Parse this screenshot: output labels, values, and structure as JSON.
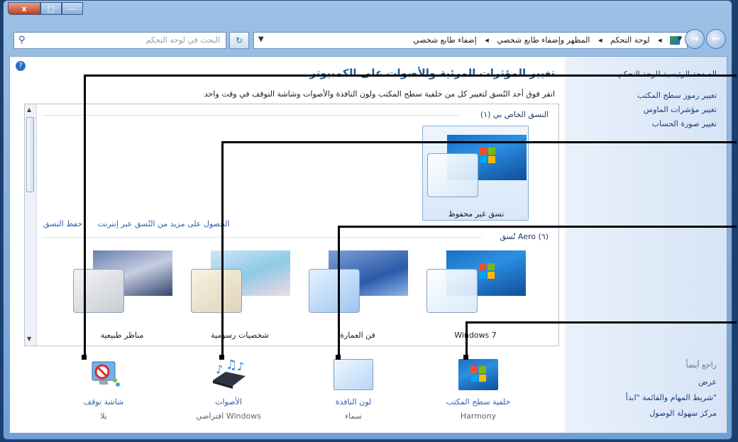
{
  "window": {
    "caption": {
      "close": "x",
      "maximize": "□",
      "minimize": "—"
    }
  },
  "address": {
    "search_placeholder": "البحث في لوحة التحكم",
    "crumbs": [
      "لوحة التحكم",
      "المظهر وإضفاء طابع شخصي",
      "إضفاء طابع شخصي"
    ],
    "separator": "◂"
  },
  "sidebar": {
    "home": "الصفحة الرئيسية للوحة التحكم",
    "links": [
      "تغيير رموز سطح المكتب",
      "تغيير مؤشرات الماوس",
      "تغيير صورة الحساب"
    ],
    "see_also": "راجع أيضاً",
    "see_links": [
      "عرض",
      "شريط المهام والقائمة \"ابدأ\"",
      "مركز سهولة الوصول"
    ]
  },
  "main": {
    "title": "تغيير المؤثرات المرئية والأصوات على الكمبيوتر",
    "description": "انقر فوق أحد النُسق لتغيير كل من خلفية سطح المكتب ولون النافذة والأصوات وشاشة التوقف في وقت واحد",
    "my_themes_header": "النسق الخاص بي (١)",
    "unsaved_theme": "نسق غير محفوظ",
    "save_theme": "حفظ النسق",
    "get_more": "الحصول على مزيد من النُسق عبر إنترنت",
    "aero_header": "نُسق Aero (٦)",
    "aero_themes": [
      "Windows 7",
      "فن العمارة",
      "شخصيات رسومية",
      "مناظر طبيعية"
    ]
  },
  "bottom": {
    "desktop_background": {
      "label": "خلفية سطح المكتب",
      "value": "Harmony"
    },
    "window_color": {
      "label": "لون النافذة",
      "value": "سماء"
    },
    "sounds": {
      "label": "الأصوات",
      "value": "افتراضي Windows"
    },
    "screen_saver": {
      "label": "شاشة توقف",
      "value": "بلا"
    }
  },
  "icons": {
    "help": "?",
    "search": "⚲",
    "refresh": "↻",
    "dropdown": "▼",
    "back": "←",
    "forward": "→"
  }
}
